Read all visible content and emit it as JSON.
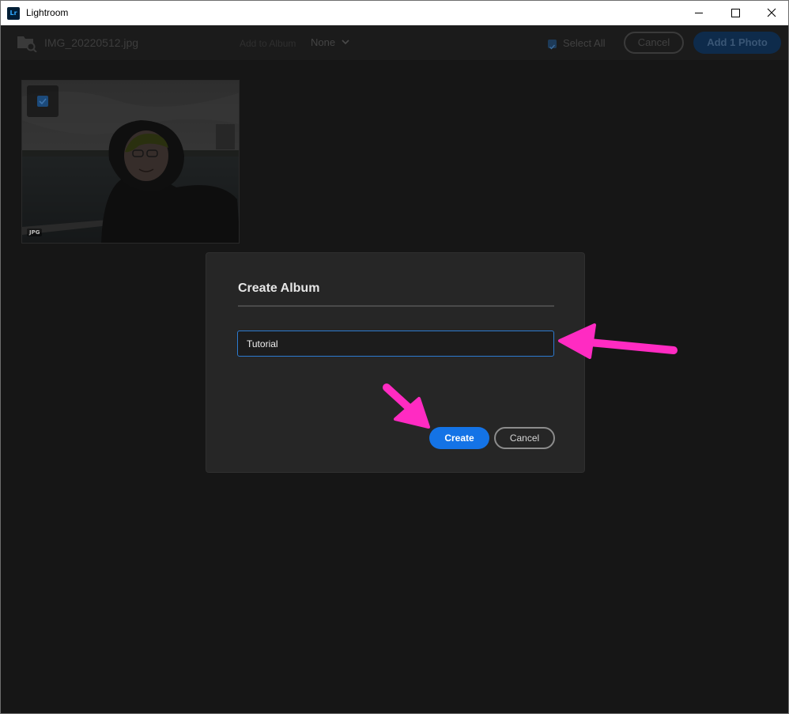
{
  "window": {
    "title": "Lightroom",
    "logo_text": "Lr"
  },
  "toolbar": {
    "file_name": "IMG_20220512.jpg",
    "add_to_album_label": "Add to Album",
    "album_value": "None",
    "select_all_label": "Select All",
    "select_all_checked": true,
    "cancel_label": "Cancel",
    "add_label": "Add 1 Photo"
  },
  "thumbnail": {
    "selected": true,
    "format_badge": "JPG"
  },
  "dialog": {
    "title": "Create Album",
    "input_value": "Tutorial",
    "create_label": "Create",
    "cancel_label": "Cancel"
  },
  "colors": {
    "accent": "#1473e6",
    "annotation_arrow": "#ff2bc2",
    "dialog_bg": "#262626",
    "app_bg": "#161616"
  },
  "icons": {
    "file": "folder-search-icon",
    "chevron": "chevron-down-icon",
    "minimize": "minimize-icon",
    "maximize": "maximize-icon",
    "close": "close-icon"
  }
}
